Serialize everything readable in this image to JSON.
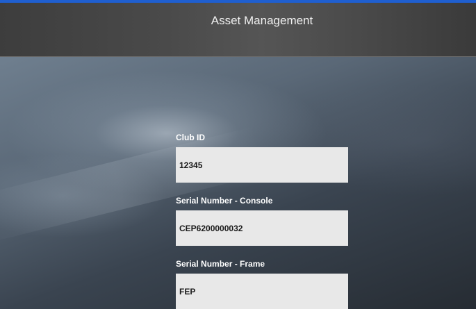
{
  "header": {
    "title": "Asset Management"
  },
  "colors": {
    "accent_bar": "#1f5fd0",
    "header_bg": "#4a4a4a",
    "input_bg": "#e8e8e8",
    "label_text": "#ffffff"
  },
  "form": {
    "club_id": {
      "label": "Club ID",
      "value": "12345"
    },
    "serial_console": {
      "label": "Serial Number - Console",
      "value": "CEP6200000032"
    },
    "serial_frame": {
      "label": "Serial Number - Frame",
      "value": "FEP"
    }
  }
}
